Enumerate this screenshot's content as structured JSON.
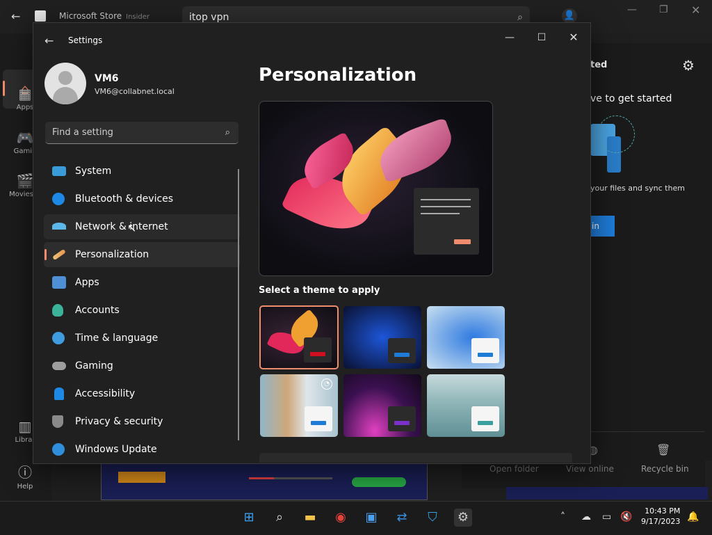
{
  "store": {
    "title": "Microsoft Store",
    "badge": "Insider",
    "search_value": "itop vpn",
    "rail": [
      {
        "label": "Apps"
      },
      {
        "label": "Gamin"
      },
      {
        "label": "Movies &"
      },
      {
        "label": "Librar"
      },
      {
        "label": "Help"
      }
    ],
    "right_heading": "ted",
    "right_text": "ve to get started",
    "right_subtext": "your files and sync them",
    "right_button": "in",
    "card_actions": [
      "Open folder",
      "View online",
      "Recycle bin"
    ]
  },
  "settings": {
    "title": "Settings",
    "user": {
      "name": "VM6",
      "email": "VM6@collabnet.local"
    },
    "search_placeholder": "Find a setting",
    "nav": [
      {
        "label": "System",
        "color": "#3a9bd9"
      },
      {
        "label": "Bluetooth & devices",
        "color": "#1e88e5"
      },
      {
        "label": "Network & internet",
        "color": "#5bb8e8"
      },
      {
        "label": "Personalization",
        "color": "#e88f4a"
      },
      {
        "label": "Apps",
        "color": "#4e8fd6"
      },
      {
        "label": "Accounts",
        "color": "#3ab39a"
      },
      {
        "label": "Time & language",
        "color": "#3f9cdf"
      },
      {
        "label": "Gaming",
        "color": "#9e9e9e"
      },
      {
        "label": "Accessibility",
        "color": "#1e88e5"
      },
      {
        "label": "Privacy & security",
        "color": "#8a8a8a"
      },
      {
        "label": "Windows Update",
        "color": "#2f8fdc"
      }
    ],
    "page_title": "Personalization",
    "theme_label": "Select a theme to apply"
  },
  "taskbar": {
    "time": "10:43 PM",
    "date": "9/17/2023"
  }
}
